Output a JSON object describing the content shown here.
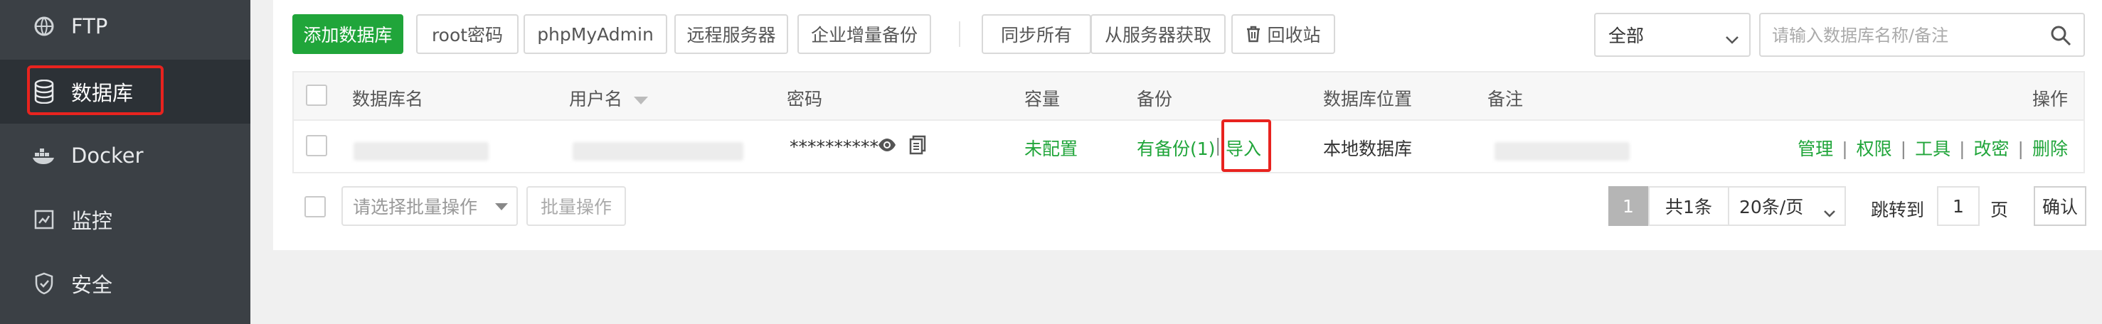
{
  "sidebar": {
    "items": [
      {
        "label": "FTP",
        "icon": "ftp-icon"
      },
      {
        "label": "数据库",
        "icon": "database-icon",
        "active": true
      },
      {
        "label": "Docker",
        "icon": "docker-icon"
      },
      {
        "label": "监控",
        "icon": "monitor-icon"
      },
      {
        "label": "安全",
        "icon": "shield-icon"
      }
    ]
  },
  "toolbar": {
    "add_db": "添加数据库",
    "root_pwd": "root密码",
    "phpmyadmin": "phpMyAdmin",
    "remote": "远程服务器",
    "incr_backup": "企业增量备份",
    "sync_all": "同步所有",
    "fetch_server": "从服务器获取",
    "recycle": "回收站",
    "filter_value": "全部",
    "search_placeholder": "请输入数据库名称/备注"
  },
  "table": {
    "headers": {
      "name": "数据库名",
      "user": "用户名",
      "password": "密码",
      "capacity": "容量",
      "backup": "备份",
      "location": "数据库位置",
      "note": "备注",
      "actions": "操作"
    },
    "rows": [
      {
        "password": "**********",
        "capacity": "未配置",
        "backup": "有备份(1)",
        "backup_sep": "|",
        "import": "导入",
        "location": "本地数据库",
        "actions": [
          "管理",
          "权限",
          "工具",
          "改密",
          "删除"
        ],
        "action_sep": "|"
      }
    ]
  },
  "footer": {
    "batch_placeholder": "请选择批量操作",
    "batch_button": "批量操作",
    "current_page": "1",
    "total": "共1条",
    "per_page": "20条/页",
    "jump_label": "跳转到",
    "jump_value": "1",
    "page_unit": "页",
    "confirm": "确认"
  },
  "colors": {
    "sidebar_bg": "#3b4045",
    "accent_green": "#20a53a",
    "highlight_red": "#e8231f"
  }
}
